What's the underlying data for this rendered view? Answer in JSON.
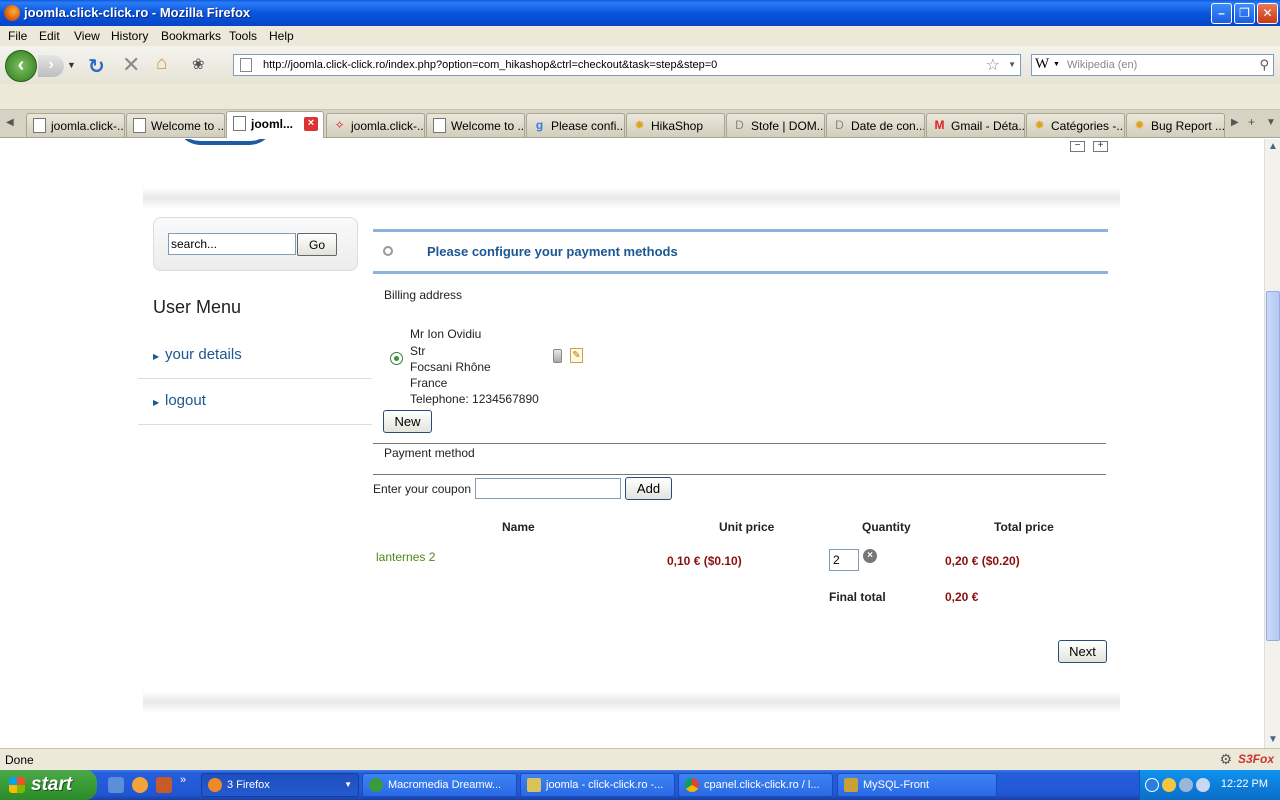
{
  "window": {
    "title": "joomla.click-click.ro - Mozilla Firefox",
    "min_glyph": "–",
    "max_glyph": "❐",
    "close_glyph": "✕"
  },
  "menu": [
    "File",
    "Edit",
    "View",
    "History",
    "Bookmarks",
    "Tools",
    "Help"
  ],
  "nav": {
    "url": "http://joomla.click-click.ro/index.php?option=com_hikashop&ctrl=checkout&task=step&step=0",
    "search_placeholder": "Wikipedia (en)",
    "search_engine_glyph": "W"
  },
  "tabs": [
    {
      "label": "joomla.click-...",
      "icon": "page-icon"
    },
    {
      "label": "Welcome to ...",
      "icon": "page-icon"
    },
    {
      "label": "jooml...",
      "icon": "page-icon",
      "active": true
    },
    {
      "label": "joomla.click-...",
      "icon": "joomla-icon"
    },
    {
      "label": "Welcome to ...",
      "icon": "page-icon"
    },
    {
      "label": "Please confi...",
      "icon": "google-icon"
    },
    {
      "label": "HikaShop",
      "icon": "hikashop-icon"
    },
    {
      "label": "Stofe | DOM...",
      "icon": "d-icon"
    },
    {
      "label": "Date de con...",
      "icon": "d-icon"
    },
    {
      "label": "Gmail - Déta...",
      "icon": "gmail-icon"
    },
    {
      "label": "Catégories -...",
      "icon": "hikashop-icon"
    },
    {
      "label": "Bug Report ...",
      "icon": "hikashop-icon"
    }
  ],
  "page": {
    "search": {
      "value": "search...",
      "button": "Go"
    },
    "font_controls": {
      "decrease": "−",
      "increase": "+"
    },
    "user_menu": {
      "title": "User Menu",
      "items": [
        "your details",
        "logout"
      ]
    },
    "checkout": {
      "step_label": "Please configure your payment methods",
      "billing_title": "Billing address",
      "address": [
        "Mr Ion Ovidiu",
        "Str",
        "Focsani Rhône",
        "France",
        "Telephone: 1234567890"
      ],
      "new_button": "New",
      "payment_title": "Payment method",
      "coupon_label": "Enter your coupon",
      "coupon_value": "",
      "add_button": "Add",
      "cart": {
        "headers": [
          "Name",
          "Unit price",
          "Quantity",
          "Total price"
        ],
        "product": {
          "name": "lanternes 2",
          "unit_price": "0,10 € ($0.10)",
          "quantity": "2",
          "total_price": "0,20 € ($0.20)"
        },
        "final_total_label": "Final total",
        "final_total": "0,20 €"
      },
      "next_button": "Next"
    }
  },
  "status": {
    "text": "Done",
    "addon": "S3Fox"
  },
  "taskbar": {
    "start": "start",
    "tasks": [
      {
        "label": "3 Firefox",
        "icon": "firefox-icon",
        "active": true
      },
      {
        "label": "Macromedia Dreamw...",
        "icon": "dreamweaver-icon"
      },
      {
        "label": "joomla - click-click.ro -...",
        "icon": "explorer-icon"
      },
      {
        "label": "cpanel.click-click.ro / l...",
        "icon": "chrome-icon"
      },
      {
        "label": "MySQL-Front",
        "icon": "mysql-icon"
      }
    ],
    "clock": "12:22 PM"
  }
}
